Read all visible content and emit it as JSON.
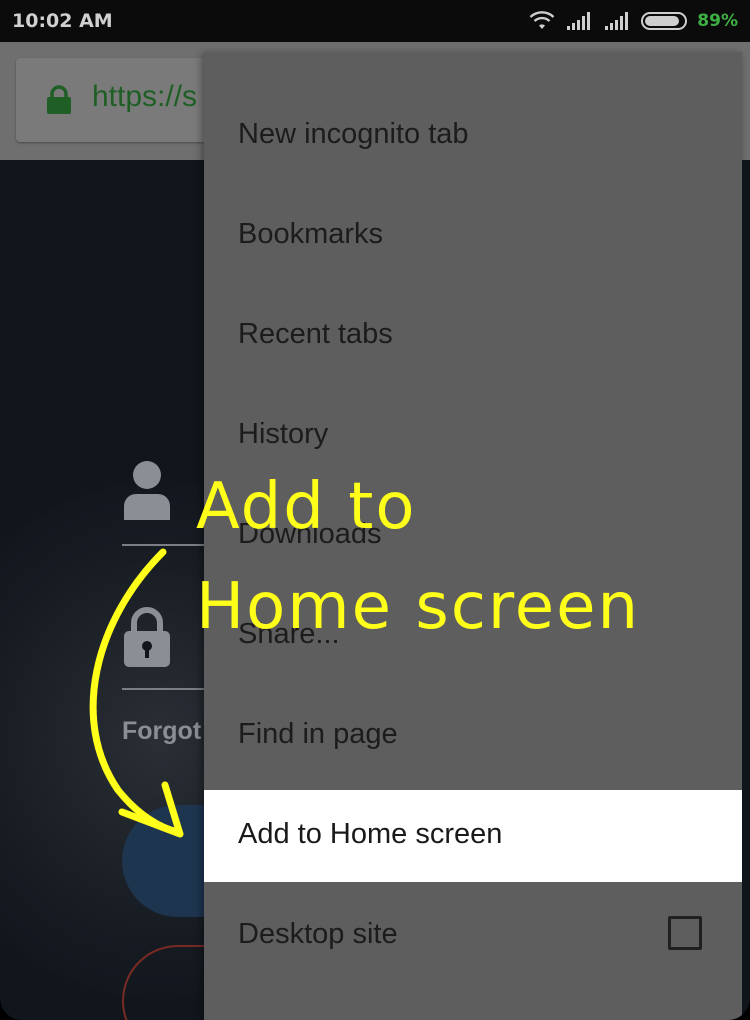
{
  "status_bar": {
    "time": "10:02 AM",
    "battery_percent": "89%",
    "battery_level": 0.89,
    "icons": [
      "wifi-icon",
      "signal-icon",
      "signal-icon",
      "battery-icon"
    ]
  },
  "browser": {
    "url_text": "https://s",
    "lock_color": "#1f5f26"
  },
  "page": {
    "forgot_text": "Forgot"
  },
  "menu": {
    "items": [
      {
        "label": "New incognito tab"
      },
      {
        "label": "Bookmarks"
      },
      {
        "label": "Recent tabs"
      },
      {
        "label": "History"
      },
      {
        "label": "Downloads"
      },
      {
        "label": "Share..."
      },
      {
        "label": "Find in page"
      },
      {
        "label": "Add to Home screen",
        "highlighted": true
      },
      {
        "label": "Desktop site",
        "checkbox": false
      }
    ]
  },
  "annotation": {
    "line1": "Add to",
    "line2": "Home screen",
    "color": "#ffff1a"
  }
}
